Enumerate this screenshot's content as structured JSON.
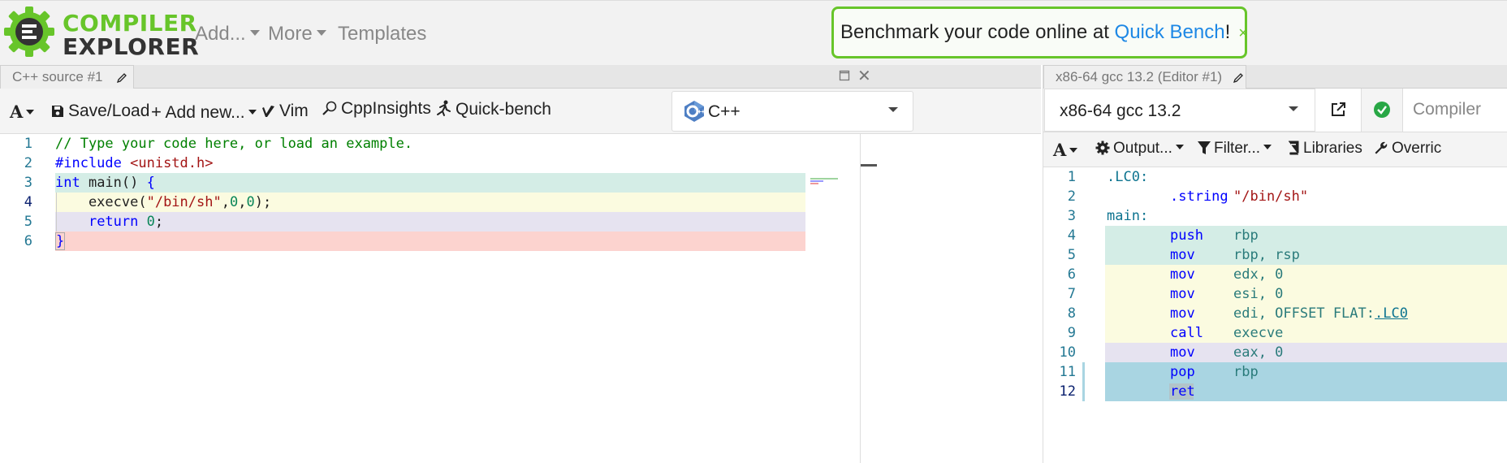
{
  "header": {
    "logo_top": "COMPILER",
    "logo_bottom": "EXPLORER",
    "nav": [
      {
        "label": "Add...",
        "has_caret": true
      },
      {
        "label": "More",
        "has_caret": true
      },
      {
        "label": "Templates",
        "has_caret": false
      }
    ],
    "promo": {
      "prefix": "Benchmark your code online at ",
      "link": "Quick Bench",
      "suffix": "!",
      "close": "×"
    }
  },
  "editor": {
    "tab_title": "C++ source #1",
    "toolbar": {
      "font_label": "A",
      "save_load": "Save/Load",
      "add_new": "Add new...",
      "vim": "Vim",
      "cppinsights": "CppInsights",
      "quick_bench": "Quick-bench"
    },
    "language": "C++",
    "lines": [
      {
        "n": "1",
        "text": "// Type your code here, or load an example."
      },
      {
        "n": "2",
        "text": "#include <unistd.h>"
      },
      {
        "n": "3",
        "text": "int main() {"
      },
      {
        "n": "4",
        "text": "    execve(\"/bin/sh\",0,0);"
      },
      {
        "n": "5",
        "text": "    return 0;"
      },
      {
        "n": "6",
        "text": "}"
      }
    ]
  },
  "compiler": {
    "tab_title": "x86-64 gcc 13.2 (Editor #1)",
    "name": "x86-64 gcc 13.2",
    "options_placeholder": "Compiler",
    "toolbar": {
      "font_label": "A",
      "output": "Output...",
      "filter": "Filter...",
      "libraries": "Libraries",
      "overrides": "Overric"
    },
    "asm": [
      {
        "n": "1",
        "label": ".LC0:"
      },
      {
        "n": "2",
        "ins": ".string",
        "ops": "\"/bin/sh\""
      },
      {
        "n": "3",
        "label": "main:"
      },
      {
        "n": "4",
        "ins": "push",
        "ops": "rbp"
      },
      {
        "n": "5",
        "ins": "mov",
        "ops": "rbp, rsp"
      },
      {
        "n": "6",
        "ins": "mov",
        "ops": "edx, 0"
      },
      {
        "n": "7",
        "ins": "mov",
        "ops": "esi, 0"
      },
      {
        "n": "8",
        "ins": "mov",
        "ops": "edi, OFFSET FLAT:",
        "link": ".LC0"
      },
      {
        "n": "9",
        "ins": "call",
        "ops": "execve"
      },
      {
        "n": "10",
        "ins": "mov",
        "ops": "eax, 0"
      },
      {
        "n": "11",
        "ins": "pop",
        "ops": "rbp"
      },
      {
        "n": "12",
        "ins": "ret",
        "ops": ""
      }
    ]
  },
  "colors": {
    "brand_green": "#67c52a",
    "line_teal": "#d4ede6",
    "line_yellow": "#fbfbe0",
    "line_lavender": "#e6e3f0",
    "line_pink": "#fcd3cf",
    "line_blue": "#a9d5e2"
  }
}
